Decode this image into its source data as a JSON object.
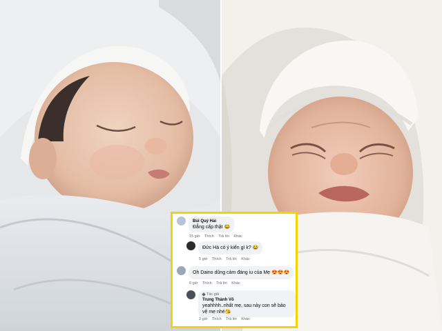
{
  "comments": [
    {
      "author": "Bùi Quý Hải",
      "text": "Đẳng cấp thật 😂",
      "time": "15 giờ",
      "like": "Thích",
      "reply": "Trả lời",
      "other": "Khác",
      "avatar_color": "#b8c4d6"
    },
    {
      "author": "",
      "text": "Đức Hà có ý kiến gì k? 😂",
      "time": "5 giờ",
      "like": "Thích",
      "reply": "Trả lời",
      "other": "Khác",
      "avatar_color": "#2b2b2b"
    },
    {
      "author": "",
      "text": "Oh Daino dũng cảm đáng iu của Mẹ 😍😍😍",
      "time": "6 giờ",
      "like": "Thích",
      "reply": "Trả lời",
      "other": "Khác",
      "avatar_color": "#9aa7b4"
    },
    {
      "badge": "Tác giả",
      "author": "Trung Thành Võ",
      "text": "yeahhhh..nhất mẹ, sau này con sẽ bảo vệ mẹ nhé😘",
      "time": "2 giờ",
      "like": "Thích",
      "reply": "Trả lời",
      "other": "Khác",
      "avatar_color": "#4a4f58"
    }
  ],
  "colors": {
    "frame": "#f4d300",
    "bubble": "#f0f2f5",
    "muted": "#65676b"
  },
  "icons": [
    "pencil-icon",
    "emoji-icon"
  ]
}
